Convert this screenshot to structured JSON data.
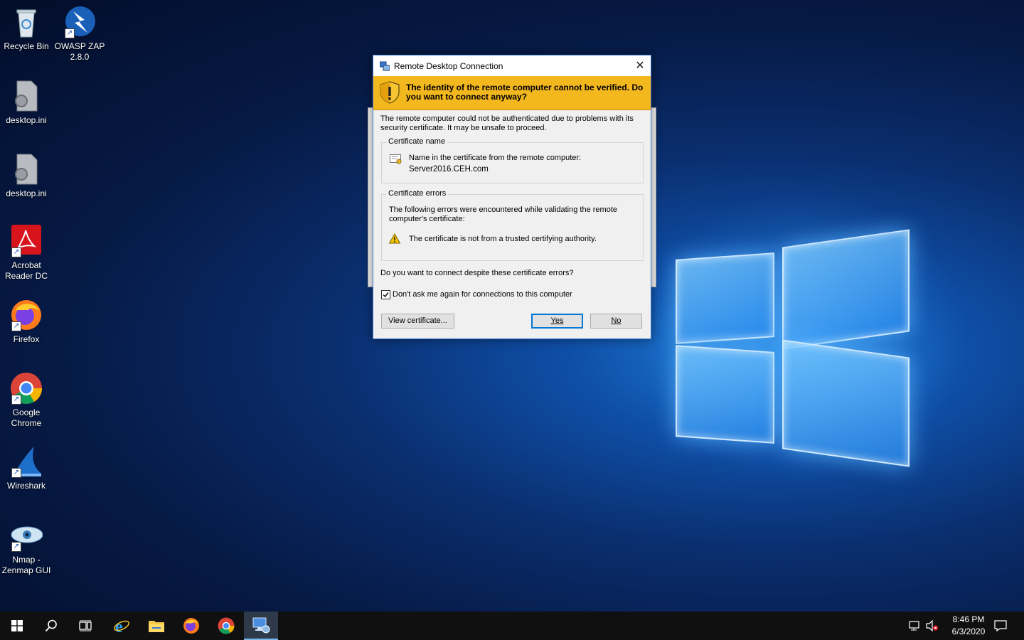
{
  "desktop": {
    "icons": [
      {
        "label": "Recycle Bin",
        "icon": "recycle-bin-icon"
      },
      {
        "label": "OWASP ZAP 2.8.0",
        "icon": "owasp-zap-icon"
      },
      {
        "label": "desktop.ini",
        "icon": "settings-file-icon"
      },
      {
        "label": "desktop.ini",
        "icon": "settings-file-icon"
      },
      {
        "label": "Acrobat Reader DC",
        "icon": "acrobat-icon"
      },
      {
        "label": "Firefox",
        "icon": "firefox-icon"
      },
      {
        "label": "Google Chrome",
        "icon": "chrome-icon"
      },
      {
        "label": "Wireshark",
        "icon": "wireshark-icon"
      },
      {
        "label": "Nmap - Zenmap GUI",
        "icon": "nmap-icon"
      }
    ]
  },
  "dialog": {
    "title": "Remote Desktop Connection",
    "close_glyph": "✕",
    "banner": "The identity of the remote computer cannot be verified. Do you want to connect anyway?",
    "intro": "The remote computer could not be authenticated due to problems with its security certificate. It may be unsafe to proceed.",
    "cert_group_label": "Certificate name",
    "cert_name_line": "Name in the certificate from the remote computer:",
    "cert_name_value": "Server2016.CEH.com",
    "errors_group_label": "Certificate errors",
    "errors_intro": "The following errors were encountered while validating the remote computer's certificate:",
    "error_item": "The certificate is not from a trusted certifying authority.",
    "question": "Do you want to connect despite these certificate errors?",
    "checkbox_label": "Don't ask me again for connections to this computer",
    "checkbox_checked": true,
    "view_cert_button": "View certificate...",
    "yes_button": "Yes",
    "no_button": "No"
  },
  "taskbar": {
    "time": "8:46 PM",
    "date": "6/3/2020"
  }
}
